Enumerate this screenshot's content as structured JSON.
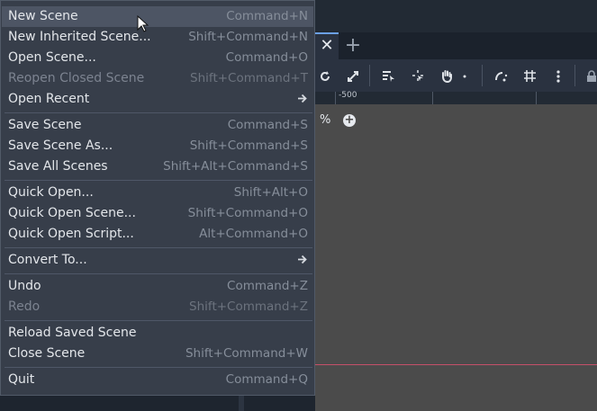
{
  "menu": {
    "items": [
      {
        "label": "New Scene",
        "shortcut": "Command+N"
      },
      {
        "label": "New Inherited Scene...",
        "shortcut": "Shift+Command+N"
      },
      {
        "label": "Open Scene...",
        "shortcut": "Command+O"
      },
      {
        "label": "Reopen Closed Scene",
        "shortcut": "Shift+Command+T"
      },
      {
        "label": "Open Recent",
        "shortcut": ""
      },
      {
        "label": "Save Scene",
        "shortcut": "Command+S"
      },
      {
        "label": "Save Scene As...",
        "shortcut": "Shift+Command+S"
      },
      {
        "label": "Save All Scenes",
        "shortcut": "Shift+Alt+Command+S"
      },
      {
        "label": "Quick Open...",
        "shortcut": "Shift+Alt+O"
      },
      {
        "label": "Quick Open Scene...",
        "shortcut": "Shift+Command+O"
      },
      {
        "label": "Quick Open Script...",
        "shortcut": "Alt+Command+O"
      },
      {
        "label": "Convert To...",
        "shortcut": ""
      },
      {
        "label": "Undo",
        "shortcut": "Command+Z"
      },
      {
        "label": "Redo",
        "shortcut": "Shift+Command+Z"
      },
      {
        "label": "Reload Saved Scene",
        "shortcut": ""
      },
      {
        "label": "Close Scene",
        "shortcut": "Shift+Command+W"
      },
      {
        "label": "Quit",
        "shortcut": "Command+Q"
      }
    ]
  },
  "editor": {
    "tab_close_glyph": "✕",
    "tab_add_glyph": "+",
    "ruler_label": "-500",
    "zoom_text": "%",
    "zoom_plus_glyph": "+"
  },
  "icons": [
    "rotate-icon",
    "scale-icon",
    "list-select-icon",
    "pivot-icon",
    "pan-hand-icon",
    "snap-icon",
    "grid-snap-icon",
    "more-options-icon",
    "lock-icon",
    "submenu-arrow-icon",
    "mouse-cursor-icon"
  ],
  "colors": {
    "accent": "#6ba0e6",
    "highlight": "#4d5564",
    "axis": "#c4506a"
  }
}
